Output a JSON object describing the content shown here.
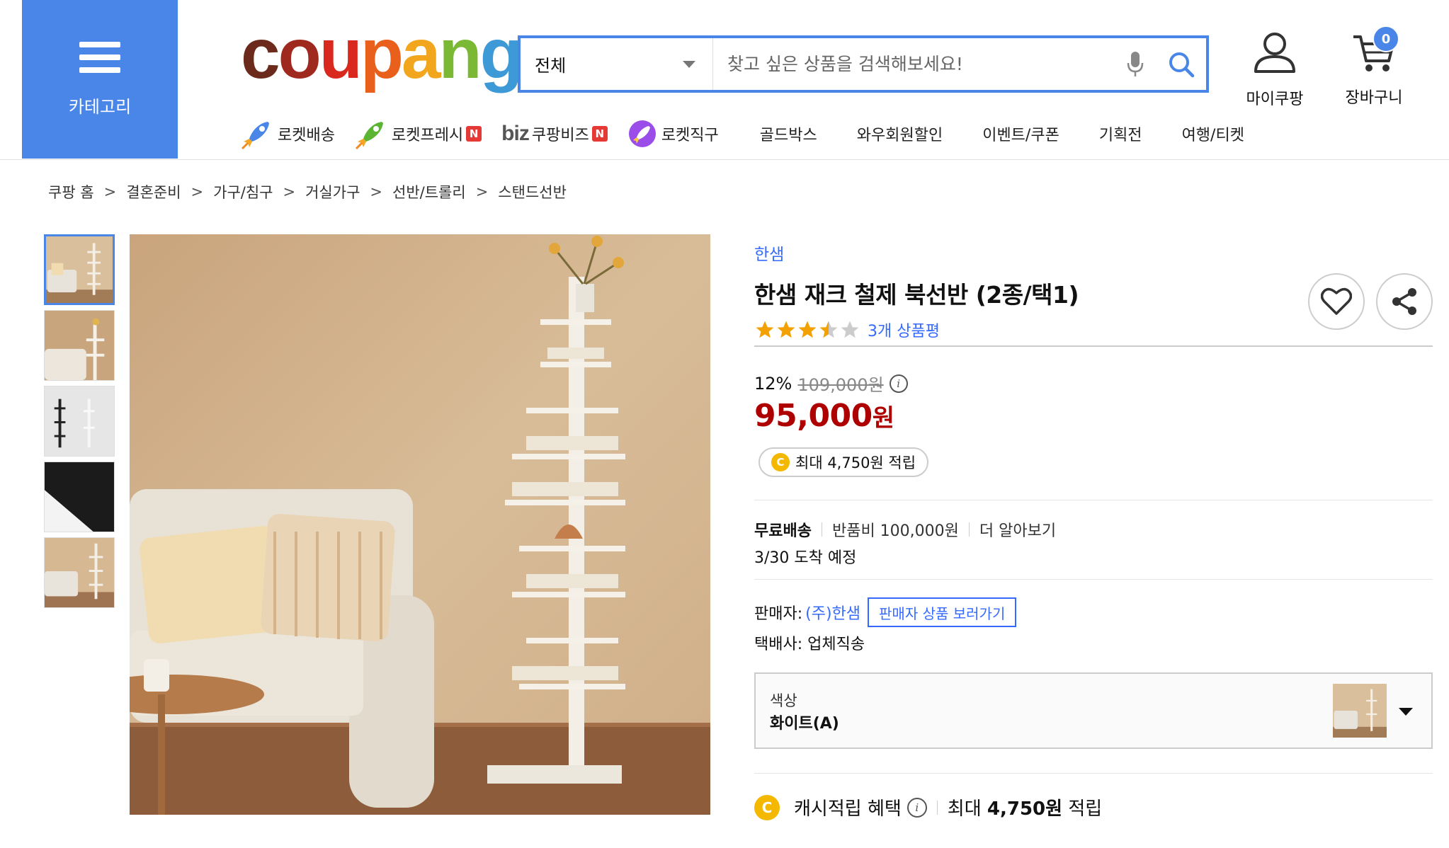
{
  "header": {
    "category_label": "카테고리",
    "search": {
      "scope": "전체",
      "placeholder": "찾고 싶은 상품을 검색해보세요!"
    },
    "my_coupang": "마이쿠팡",
    "cart": {
      "label": "장바구니",
      "count": "0"
    }
  },
  "logo": {
    "text": "coupang"
  },
  "nav": [
    {
      "label": "로켓배송",
      "icon": "rocket-icon"
    },
    {
      "label": "로켓프레시",
      "badge": "N",
      "icon": "rocket-fresh-icon"
    },
    {
      "prefix": "biz",
      "label": "쿠팡비즈",
      "badge": "N"
    },
    {
      "label": "로켓직구",
      "icon": "rocket-global-icon"
    },
    {
      "label": "골드박스"
    },
    {
      "label": "와우회원할인"
    },
    {
      "label": "이벤트/쿠폰"
    },
    {
      "label": "기획전"
    },
    {
      "label": "여행/티켓"
    }
  ],
  "breadcrumb": [
    "쿠팡 홈",
    "결혼준비",
    "가구/침구",
    "거실가구",
    "선반/트롤리",
    "스탠드선반"
  ],
  "breadcrumb_sep": ">",
  "product": {
    "brand": "한샘",
    "title": "한샘 재크 철제 북선반 (2종/택1)",
    "rating": 3.5,
    "review_count": "3개 상품평",
    "discount": "12%",
    "original_price": "109,000원",
    "sale_price": "95,000",
    "sale_unit": "원",
    "cash_reward": "최대 4,750원 적립",
    "shipping": {
      "type": "무료배송",
      "return_fee": "반품비 100,000원",
      "more": "더 알아보기",
      "arrival": "3/30 도착 예정"
    },
    "seller": {
      "label": "판매자:",
      "name": "(주)한샘",
      "button": "판매자 상품 보러가기"
    },
    "courier": "택배사: 업체직송",
    "option": {
      "label": "색상",
      "value": "화이트(A)"
    },
    "cash_benefit": {
      "label": "캐시적립 혜택",
      "prefix": "최대",
      "amount": "4,750원",
      "suffix": "적립"
    }
  },
  "colors": {
    "accent": "#4a86e8",
    "link": "#346aff",
    "price": "#ae0000",
    "star": "#f2a100"
  }
}
